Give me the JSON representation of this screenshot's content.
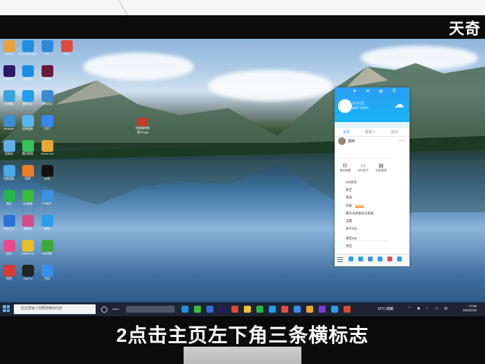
{
  "watermark": "天奇",
  "caption": "2点击主页左下角三条横标志",
  "colors": {
    "qq_blue": "#2b9df5",
    "taskbar": "#1d2533",
    "vip_badge": "#f39a1e"
  },
  "desktop": {
    "file_label": "检查事件概要4%.jpg",
    "icons": [
      {
        "label": "Adobe",
        "color": "#e9a23b"
      },
      {
        "label": "Microsoft Edge",
        "color": "#1f8fe0"
      },
      {
        "label": "VS",
        "color": "#2e8ad8"
      },
      {
        "label": "PDF",
        "color": "#e04a3a"
      },
      {
        "label": "Premiere",
        "color": "#2a1a66"
      },
      {
        "label": "QQ影音",
        "color": "#1e8fe0"
      },
      {
        "label": "Adobe",
        "color": "#6a1a3a"
      },
      {
        "label": "此电脑",
        "color": "#3aa3e0"
      },
      {
        "label": "腾讯QQ",
        "color": "#1ea0f0"
      },
      {
        "label": "360安全",
        "color": "#3c8ad0"
      },
      {
        "label": "Network",
        "color": "#3a90d0"
      },
      {
        "label": "控制面板",
        "color": "#58b7ef"
      },
      {
        "label": "钉钉",
        "color": "#3788f0"
      },
      {
        "label": "回收站",
        "color": "#5faee8"
      },
      {
        "label": "腾讯视频",
        "color": "#3ac05a"
      },
      {
        "label": "iDown.net",
        "color": "#e8a634"
      },
      {
        "label": "控制面板",
        "color": "#4aa7e8"
      },
      {
        "label": "剪映",
        "color": "#f07c2a"
      },
      {
        "label": "抖音",
        "color": "#111111"
      },
      {
        "label": "微信",
        "color": "#28b54a"
      },
      {
        "label": "360极速",
        "color": "#3dbb3d"
      },
      {
        "label": "PP助手",
        "color": "#3d8fe0"
      },
      {
        "label": "安全卫士",
        "color": "#2b73d6"
      },
      {
        "label": "爱奇艺",
        "color": "#d64a8a"
      },
      {
        "label": "酷狗",
        "color": "#2a9ee8"
      },
      {
        "label": "应用",
        "color": "#e84a8a"
      },
      {
        "label": "FastStone",
        "color": "#e8c02a"
      },
      {
        "label": "360浏览",
        "color": "#3aaa3a"
      },
      {
        "label": "快剪",
        "color": "#d83a3a"
      },
      {
        "label": "CapCut",
        "color": "#222222"
      },
      {
        "label": "文档",
        "color": "#3a8ee8"
      }
    ]
  },
  "qq": {
    "name": "小小白",
    "signature": "编辑个性签名",
    "tabs": [
      "消息",
      "联系人",
      "空间"
    ],
    "contact": {
      "name": "烟雨",
      "time": "10:11"
    },
    "quick_buttons": [
      {
        "icon": "bookmark-icon",
        "label": "我的收藏"
      },
      {
        "icon": "folder-icon",
        "label": "文件助手"
      },
      {
        "icon": "message-icon",
        "label": "消息管理"
      }
    ],
    "menu_items": [
      "QQ会员",
      "安全",
      "帮助",
      "升级",
      "聊天记录备份与恢复",
      "设置",
      "关于QQ"
    ],
    "upgrade_badge": "NEW",
    "lock": "锁定QQ",
    "exit": "退出"
  },
  "taskbar": {
    "search_placeholder": "在这里输入你要搜索的内容",
    "temperature": "15°C 晴朗",
    "time": "17:05",
    "date": "2022/2/30"
  }
}
